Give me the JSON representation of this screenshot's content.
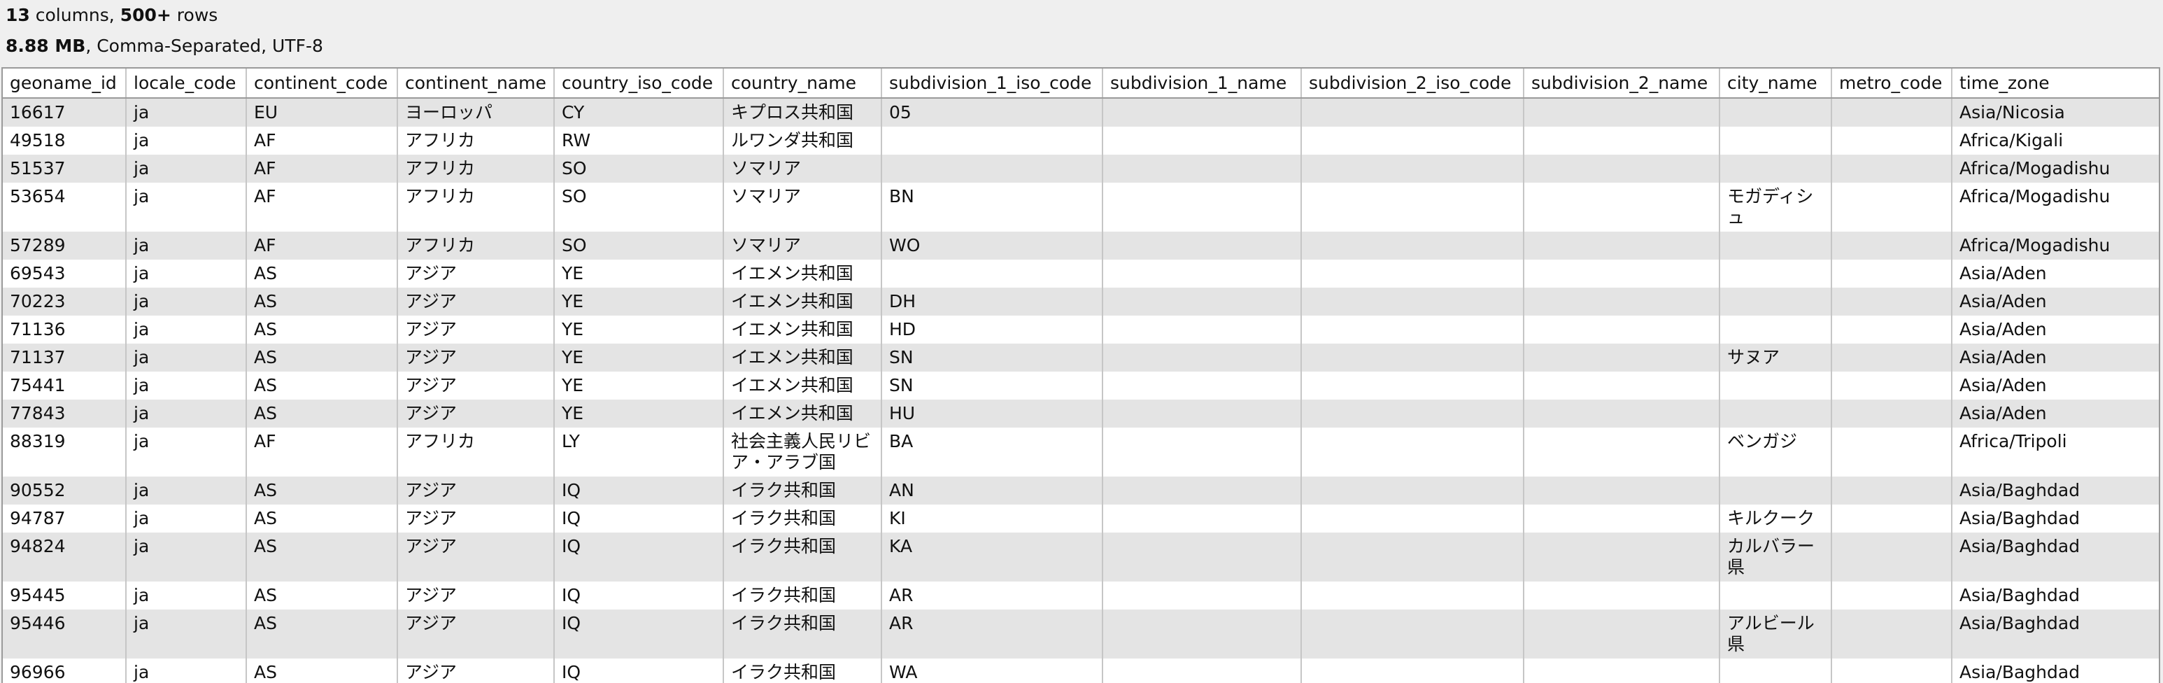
{
  "info": {
    "columns_count": "13",
    "columns_text": " columns, ",
    "rows_count": "500+",
    "rows_text": " rows",
    "size": "8.88 MB",
    "format_text": ", Comma-Separated, UTF-8"
  },
  "table": {
    "columns": [
      "geoname_id",
      "locale_code",
      "continent_code",
      "continent_name",
      "country_iso_code",
      "country_name",
      "subdivision_1_iso_code",
      "subdivision_1_name",
      "subdivision_2_iso_code",
      "subdivision_2_name",
      "city_name",
      "metro_code",
      "time_zone"
    ],
    "rows": [
      [
        "16617",
        "ja",
        "EU",
        "ヨーロッパ",
        "CY",
        "キプロス共和国",
        "05",
        "",
        "",
        "",
        "",
        "",
        "Asia/Nicosia"
      ],
      [
        "49518",
        "ja",
        "AF",
        "アフリカ",
        "RW",
        "ルワンダ共和国",
        "",
        "",
        "",
        "",
        "",
        "",
        "Africa/Kigali"
      ],
      [
        "51537",
        "ja",
        "AF",
        "アフリカ",
        "SO",
        "ソマリア",
        "",
        "",
        "",
        "",
        "",
        "",
        "Africa/Mogadishu"
      ],
      [
        "53654",
        "ja",
        "AF",
        "アフリカ",
        "SO",
        "ソマリア",
        "BN",
        "",
        "",
        "",
        "モガディシュ",
        "",
        "Africa/Mogadishu"
      ],
      [
        "57289",
        "ja",
        "AF",
        "アフリカ",
        "SO",
        "ソマリア",
        "WO",
        "",
        "",
        "",
        "",
        "",
        "Africa/Mogadishu"
      ],
      [
        "69543",
        "ja",
        "AS",
        "アジア",
        "YE",
        "イエメン共和国",
        "",
        "",
        "",
        "",
        "",
        "",
        "Asia/Aden"
      ],
      [
        "70223",
        "ja",
        "AS",
        "アジア",
        "YE",
        "イエメン共和国",
        "DH",
        "",
        "",
        "",
        "",
        "",
        "Asia/Aden"
      ],
      [
        "71136",
        "ja",
        "AS",
        "アジア",
        "YE",
        "イエメン共和国",
        "HD",
        "",
        "",
        "",
        "",
        "",
        "Asia/Aden"
      ],
      [
        "71137",
        "ja",
        "AS",
        "アジア",
        "YE",
        "イエメン共和国",
        "SN",
        "",
        "",
        "",
        "サヌア",
        "",
        "Asia/Aden"
      ],
      [
        "75441",
        "ja",
        "AS",
        "アジア",
        "YE",
        "イエメン共和国",
        "SN",
        "",
        "",
        "",
        "",
        "",
        "Asia/Aden"
      ],
      [
        "77843",
        "ja",
        "AS",
        "アジア",
        "YE",
        "イエメン共和国",
        "HU",
        "",
        "",
        "",
        "",
        "",
        "Asia/Aden"
      ],
      [
        "88319",
        "ja",
        "AF",
        "アフリカ",
        "LY",
        "社会主義人民リビア・アラブ国",
        "BA",
        "",
        "",
        "",
        "ベンガジ",
        "",
        "Africa/Tripoli"
      ],
      [
        "90552",
        "ja",
        "AS",
        "アジア",
        "IQ",
        "イラク共和国",
        "AN",
        "",
        "",
        "",
        "",
        "",
        "Asia/Baghdad"
      ],
      [
        "94787",
        "ja",
        "AS",
        "アジア",
        "IQ",
        "イラク共和国",
        "KI",
        "",
        "",
        "",
        "キルクーク",
        "",
        "Asia/Baghdad"
      ],
      [
        "94824",
        "ja",
        "AS",
        "アジア",
        "IQ",
        "イラク共和国",
        "KA",
        "",
        "",
        "",
        "カルバラー県",
        "",
        "Asia/Baghdad"
      ],
      [
        "95445",
        "ja",
        "AS",
        "アジア",
        "IQ",
        "イラク共和国",
        "AR",
        "",
        "",
        "",
        "",
        "",
        "Asia/Baghdad"
      ],
      [
        "95446",
        "ja",
        "AS",
        "アジア",
        "IQ",
        "イラク共和国",
        "AR",
        "",
        "",
        "",
        "アルビール県",
        "",
        "Asia/Baghdad"
      ],
      [
        "96966",
        "ja",
        "AS",
        "アジア",
        "IQ",
        "イラク共和国",
        "WA",
        "",
        "",
        "",
        "",
        "",
        "Asia/Baghdad"
      ]
    ]
  }
}
